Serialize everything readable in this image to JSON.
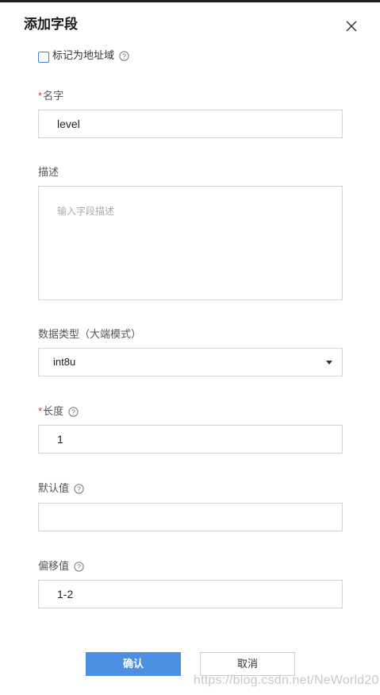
{
  "dialog": {
    "title": "添加字段",
    "close_icon": "close-icon"
  },
  "mark_address": {
    "label": "标记为地址域",
    "checked": false,
    "help_icon": "question-circle-icon"
  },
  "fields": {
    "name": {
      "required_mark": "*",
      "label": "名字",
      "value": "level"
    },
    "description": {
      "label": "描述",
      "placeholder": "输入字段描述",
      "value": ""
    },
    "data_type": {
      "label": "数据类型（大端模式）",
      "selected": "int8u",
      "dropdown_icon": "caret-down-icon"
    },
    "length": {
      "required_mark": "*",
      "label": "长度",
      "value": "1",
      "help_icon": "question-circle-icon"
    },
    "default_value": {
      "label": "默认值",
      "value": "",
      "help_icon": "question-circle-icon"
    },
    "offset": {
      "label": "偏移值",
      "value": "1-2",
      "help_icon": "question-circle-icon"
    }
  },
  "buttons": {
    "confirm": "确认",
    "cancel": "取消"
  },
  "watermark": "https://blog.csdn.net/NeWorld20",
  "colors": {
    "primary": "#4d8fe0",
    "required": "#e0352b",
    "checkbox_border": "#4a7fcf"
  }
}
